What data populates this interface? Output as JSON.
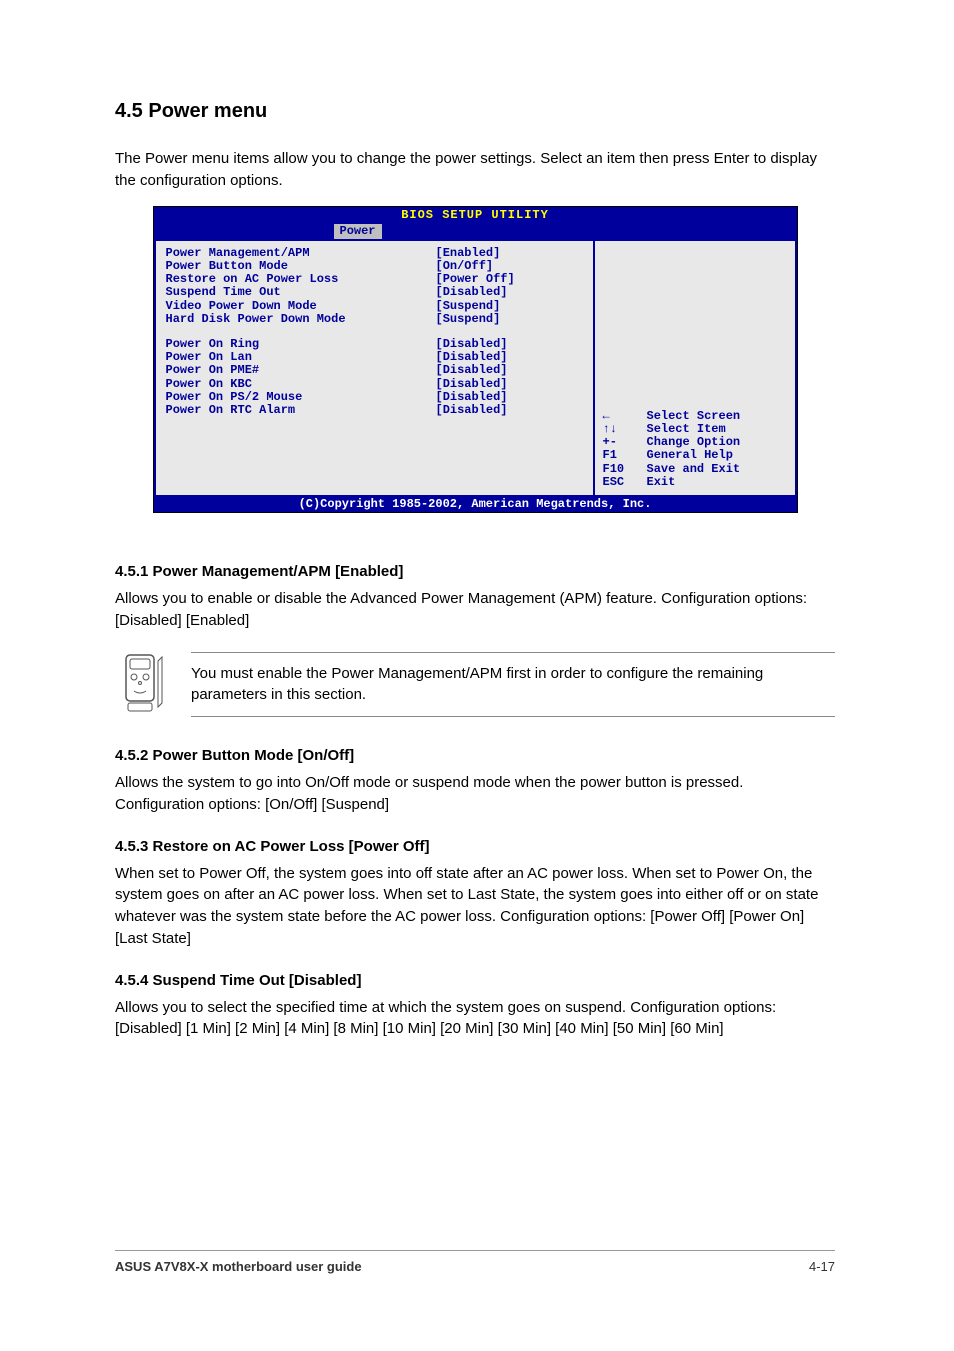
{
  "section_title": "4.5 Power menu",
  "intro_text": "The Power menu items allow you to change the power settings. Select an item then press Enter to display the configuration options.",
  "bios": {
    "title": "BIOS SETUP UTILITY",
    "tab": "Power",
    "group1": [
      {
        "label": "Power Management/APM",
        "value": "[Enabled]"
      },
      {
        "label": "Power Button Mode",
        "value": "[On/Off]"
      },
      {
        "label": "Restore on AC Power Loss",
        "value": "[Power Off]"
      },
      {
        "label": "Suspend Time Out",
        "value": "[Disabled]"
      },
      {
        "label": "Video Power Down Mode",
        "value": "[Suspend]"
      },
      {
        "label": "Hard Disk Power Down Mode",
        "value": "[Suspend]"
      }
    ],
    "group2": [
      {
        "label": "Power On Ring",
        "value": "[Disabled]"
      },
      {
        "label": "Power On Lan",
        "value": "[Disabled]"
      },
      {
        "label": "Power On PME#",
        "value": "[Disabled]"
      },
      {
        "label": "Power On KBC",
        "value": "[Disabled]"
      },
      {
        "label": "Power On PS/2 Mouse",
        "value": "[Disabled]"
      },
      {
        "label": "Power On RTC Alarm",
        "value": "[Disabled]"
      }
    ],
    "help": [
      {
        "key": "←",
        "desc": "Select Screen"
      },
      {
        "key": "↑↓",
        "desc": "Select Item"
      },
      {
        "key": "+-",
        "desc": "Change Option"
      },
      {
        "key": "F1",
        "desc": "General Help"
      },
      {
        "key": "F10",
        "desc": "Save and Exit"
      },
      {
        "key": "ESC",
        "desc": "Exit"
      }
    ],
    "footer": "(C)Copyright 1985-2002, American Megatrends, Inc."
  },
  "sub1": {
    "title": "4.5.1 Power Management/APM [Enabled]",
    "body": "Allows you to enable or disable the Advanced Power Management (APM) feature. Configuration options: [Disabled] [Enabled]"
  },
  "note": "You must enable the Power Management/APM first in order to configure the remaining parameters in this section.",
  "sub2": {
    "title": "4.5.2 Power Button Mode [On/Off]",
    "body": "Allows the system to go into On/Off mode or suspend mode when the power button is pressed. Configuration options: [On/Off] [Suspend]"
  },
  "sub3": {
    "title": "4.5.3 Restore on AC Power Loss [Power Off]",
    "body": "When set to Power Off, the system goes into off state after an AC power loss. When set to Power On, the system goes on after an AC power loss. When set to Last State, the system goes into either off or on state whatever was the system state before the AC power loss. Configuration options: [Power Off] [Power On] [Last State]"
  },
  "sub4": {
    "title": "4.5.4 Suspend Time Out [Disabled]",
    "body": "Allows you to select the specified time at which the system goes on suspend. Configuration options: [Disabled] [1 Min] [2 Min] [4 Min] [8 Min] [10 Min] [20 Min] [30 Min] [40 Min] [50 Min] [60 Min]"
  },
  "footer": {
    "left": "ASUS A7V8X-X motherboard user guide",
    "right": "4-17"
  }
}
